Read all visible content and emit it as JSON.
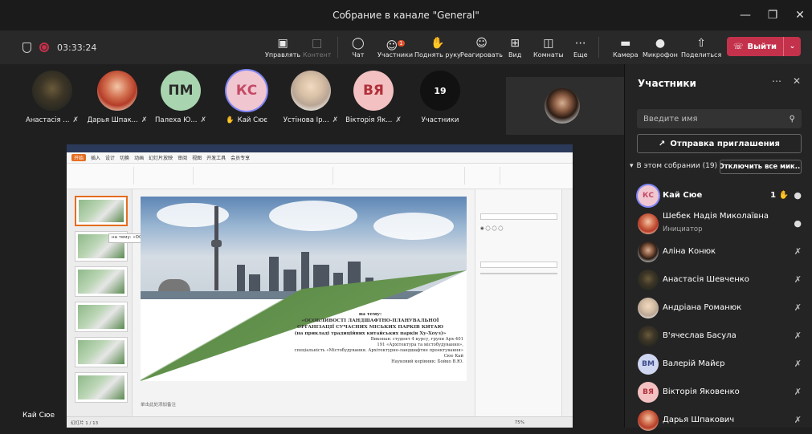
{
  "window": {
    "title": "Собрание в канале \"General\""
  },
  "status": {
    "timer": "03:33:24"
  },
  "toolbar": {
    "manage": "Управлять",
    "content": "Контент",
    "chat": "Чат",
    "participants": "Участники",
    "participants_badge": "1",
    "raise_hand": "Поднять руку",
    "react": "Реагировать",
    "view": "Вид",
    "rooms": "Комнаты",
    "more": "Еще",
    "camera": "Камера",
    "mic": "Микрофон",
    "share": "Поделиться",
    "leave": "Выйти"
  },
  "gallery": [
    {
      "name": "Анастасія ...",
      "initials": ""
    },
    {
      "name": "Дарья Шпак...",
      "initials": ""
    },
    {
      "name": "Палеха Ю...",
      "initials": "ПМ",
      "color": "#a8d5b0",
      "fg": "#2b2b2b"
    },
    {
      "name": "Кай Сює",
      "initials": "КС",
      "color": "#f0c6d0",
      "fg": "#c44a64"
    },
    {
      "name": "Устінова Ір...",
      "initials": ""
    },
    {
      "name": "Вікторія Як...",
      "initials": "ВЯ",
      "color": "#f3c1c1",
      "fg": "#b0303a"
    },
    {
      "name": "Участники",
      "initials": "19",
      "color": "#111111",
      "fg": "#ffffff"
    }
  ],
  "presentation": {
    "menu": [
      "开始",
      "插入",
      "设计",
      "切换",
      "动画",
      "幻灯片放映",
      "审阅",
      "视图",
      "开发工具",
      "会员专享"
    ],
    "tooltip": "на тему: «ОСОБЛИВОС...",
    "slide_lines": [
      "на тему:",
      "«ОСОБЛИВОСТІ ЛАНДШАФТНО-ПЛАНУВАЛЬНОЇ",
      "ОРГАНІЗАЦІЇ СУЧАСНИХ МІСЬКИХ ПАРКІВ КИТАЮ",
      "(на прикладі традиційних китайських парків Ху-Хоуз)»"
    ],
    "slide_small": [
      "Виконав: студент  4  курсу,  групи  Арх-401",
      "191 «Архітектура та містобудування»,",
      "спеціальність «Містобудування. Архітектурно-ландшафтне проектування»",
      "Сюе Кай",
      "Науковий керівник: Бойко В.Ю."
    ],
    "status_text": "幻灯片 1 / 13",
    "notes_text": "单击此处添加备注",
    "zoom": "75%"
  },
  "self_label": "Кай Сюе",
  "panel": {
    "title": "Участники",
    "search_placeholder": "Введите имя",
    "invite": "Отправка приглашения",
    "section": "В этом собрании (19)",
    "mute_all": "Отключить все мик...",
    "people": [
      {
        "name": "Кай Сюе",
        "initials": "КС",
        "color": "#f0c6d0",
        "fg": "#c44a64",
        "bold": true,
        "hand": "1",
        "mic": "on"
      },
      {
        "name": "Шебек Надія Миколаївна",
        "sub": "Инициатор",
        "initials": "",
        "mic": "on"
      },
      {
        "name": "Аліна Конюк",
        "initials": "",
        "mic": "off"
      },
      {
        "name": "Анастасія Шевченко",
        "initials": "",
        "mic": "off"
      },
      {
        "name": "Андріана Романюк",
        "initials": "",
        "mic": "off"
      },
      {
        "name": "В'ячеслав Басула",
        "initials": "",
        "mic": "off"
      },
      {
        "name": "Валерій Майєр",
        "initials": "ВМ",
        "color": "#cfd6f0",
        "fg": "#3b4a8a",
        "mic": "off"
      },
      {
        "name": "Вікторія Яковенко",
        "initials": "ВЯ",
        "color": "#f3c1c1",
        "fg": "#b0303a",
        "mic": "off"
      },
      {
        "name": "Дарья Шпакович",
        "initials": "",
        "mic": "off"
      }
    ]
  }
}
